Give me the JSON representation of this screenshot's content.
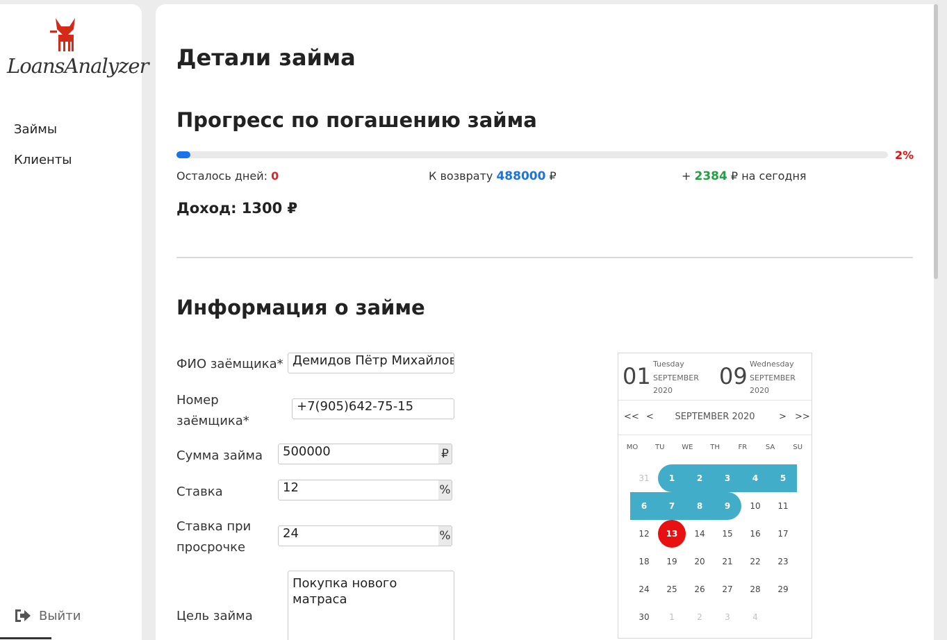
{
  "sidebar": {
    "logo_text": "LoansAnalyzer",
    "items": [
      {
        "label": "Займы"
      },
      {
        "label": "Клиенты"
      }
    ],
    "logout": "Выйти"
  },
  "page": {
    "title": "Детали займа",
    "progress": {
      "heading": "Прогресс по погашению займа",
      "percent": 2,
      "percent_label": "2%",
      "days_left_label": "Осталось дней:",
      "days_left": "0",
      "to_return_label": "К возврату",
      "to_return": "488000",
      "currency": "₽",
      "today_prefix": "+",
      "today_amount": "2384",
      "today_suffix": "на сегодня",
      "income": "Доход: 1300 ₽"
    },
    "info": {
      "heading": "Информация о займе",
      "fields": {
        "fio_label": "ФИО заёмщика*",
        "fio_value": "Демидов Пётр Михайлов",
        "phone_label_1": "Номер",
        "phone_label_2": "заёмщика*",
        "phone_value": "+7(905)642-75-15",
        "amount_label": "Сумма займа",
        "amount_value": "500000",
        "amount_unit": "₽",
        "rate_label": "Ставка",
        "rate_value": "12",
        "rate_unit": "%",
        "overdue_label_1": "Ставка при",
        "overdue_label_2": "просрочке",
        "overdue_value": "24",
        "overdue_unit": "%",
        "purpose_label": "Цель займа",
        "purpose_value": "Покупка нового матраса"
      }
    },
    "calendar": {
      "start": {
        "day": "01",
        "weekday": "Tuesday",
        "month": "SEPTEMBER",
        "year": "2020"
      },
      "end": {
        "day": "09",
        "weekday": "Wednesday",
        "month": "SEPTEMBER",
        "year": "2020"
      },
      "nav": {
        "prev_year": "<<",
        "prev": "<",
        "next": ">",
        "next_year": ">>"
      },
      "month_label": "SEPTEMBER 2020",
      "weekdays": [
        "MO",
        "TU",
        "WE",
        "TH",
        "FR",
        "SA",
        "SU"
      ],
      "weeks": [
        [
          "31",
          "1",
          "2",
          "3",
          "4",
          "5",
          ""
        ],
        [
          "6",
          "7",
          "8",
          "9",
          "10",
          "11",
          ""
        ],
        [
          "12",
          "13",
          "14",
          "15",
          "16",
          "17",
          ""
        ],
        [
          "18",
          "19",
          "20",
          "21",
          "22",
          "23",
          ""
        ],
        [
          "24",
          "25",
          "26",
          "27",
          "28",
          "29",
          ""
        ],
        [
          "30",
          "1",
          "2",
          "3",
          "4",
          "",
          ""
        ]
      ],
      "today": "13"
    },
    "colors": {
      "accent_blue": "#1a73e8",
      "range": "#42adc8",
      "today": "#e81010",
      "positive": "#22a043",
      "negative": "#e02424"
    }
  }
}
